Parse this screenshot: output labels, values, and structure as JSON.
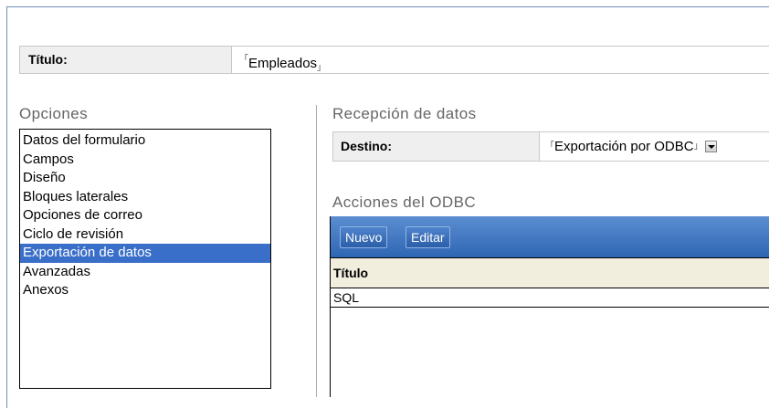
{
  "form": {
    "title_label": "Título:",
    "title_value": "Empleados"
  },
  "options": {
    "heading": "Opciones",
    "items": [
      {
        "label": "Datos del formulario",
        "selected": false
      },
      {
        "label": "Campos",
        "selected": false
      },
      {
        "label": "Diseño",
        "selected": false
      },
      {
        "label": "Bloques laterales",
        "selected": false
      },
      {
        "label": "Opciones de correo",
        "selected": false
      },
      {
        "label": "Ciclo de revisión",
        "selected": false
      },
      {
        "label": "Exportación de datos",
        "selected": true
      },
      {
        "label": "Avanzadas",
        "selected": false
      },
      {
        "label": "Anexos",
        "selected": false
      }
    ]
  },
  "reception": {
    "heading": "Recepción de datos",
    "destination_label": "Destino:",
    "destination_value": "Exportación por ODBC"
  },
  "odbc": {
    "heading": "Acciones del ODBC",
    "toolbar": {
      "new_label": "Nuevo",
      "edit_label": "Editar"
    },
    "columns": [
      "Título"
    ],
    "rows": [
      "SQL"
    ]
  },
  "colors": {
    "selection": "#3a6fc9",
    "toolbar": "#2f66b4",
    "header_bg": "#f1eede"
  },
  "icons": {
    "field_mark_open": "「",
    "field_mark_close": "」",
    "dropdown": "chevron-down-icon"
  }
}
